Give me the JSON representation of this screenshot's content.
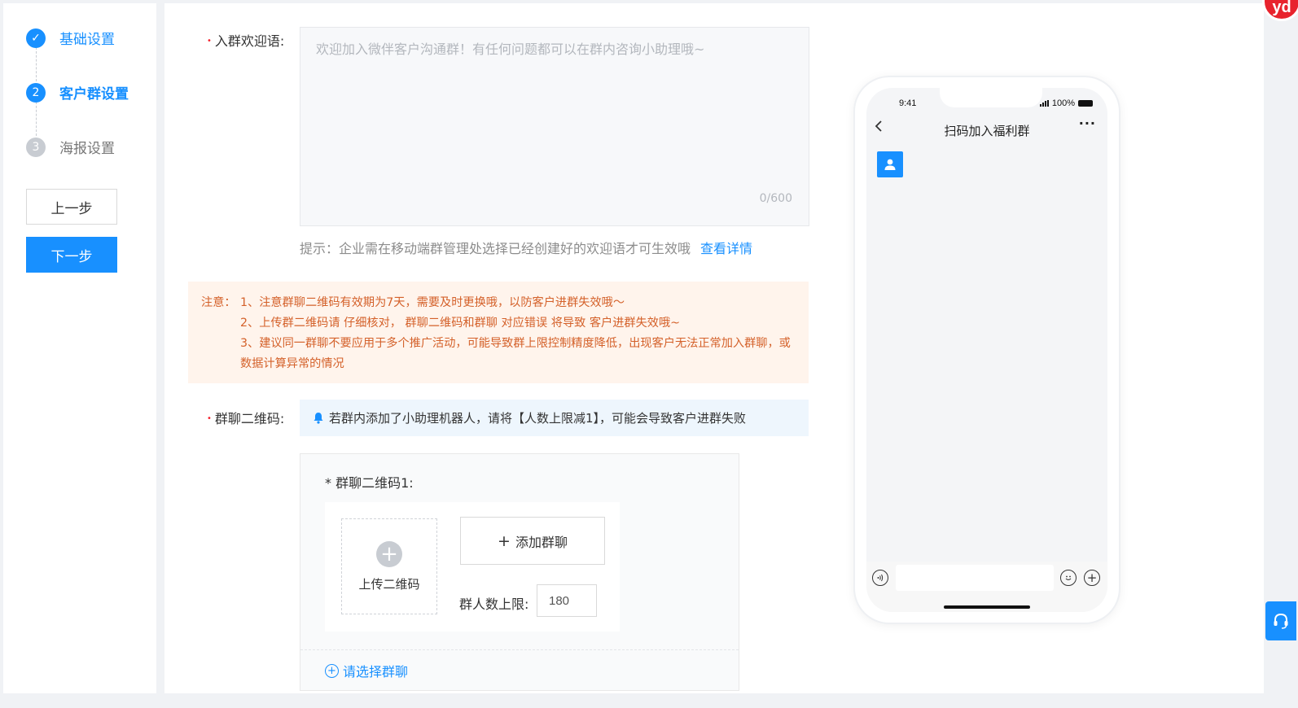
{
  "steps": [
    {
      "num": "✓",
      "label": "基础设置",
      "state": "done"
    },
    {
      "num": "2",
      "label": "客户群设置",
      "state": "active"
    },
    {
      "num": "3",
      "label": "海报设置",
      "state": "wait"
    }
  ],
  "buttons": {
    "prev": "上一步",
    "next": "下一步"
  },
  "welcome": {
    "label": "入群欢迎语:",
    "placeholder": "欢迎加入微伴客户沟通群！有任何问题都可以在群内咨询小助理哦~",
    "counter": "0/600",
    "tip": "提示：企业需在移动端群管理处选择已经创建好的欢迎语才可生效哦",
    "tip_link": "查看详情"
  },
  "notice": {
    "prefix": "注意：",
    "lines": [
      "1、注意群聊二维码有效期为7天，需要及时更换哦，以防客户进群失效哦～",
      "2、上传群二维码请 仔细核对， 群聊二维码和群聊 对应错误 将导致 客户进群失效哦~",
      "3、建议同一群聊不要应用于多个推广活动，可能导致群上限控制精度降低，出现客户无法正常加入群聊，或数据计算异常的情况"
    ]
  },
  "qr": {
    "label": "群聊二维码:",
    "info": "若群内添加了小助理机器人，请将【人数上限减1】，可能会导致客户进群失败",
    "card_title": "* 群聊二维码1:",
    "upload_text": "上传二维码",
    "add_group": "添加群聊",
    "limit_label": "群人数上限:",
    "limit_value": "180",
    "select_group": "请选择群聊"
  },
  "phone": {
    "time": "9:41",
    "battery": "100%",
    "title": "扫码加入福利群",
    "more": "···"
  },
  "corner_badge": "yd",
  "colors": {
    "primary": "#1890ff",
    "notice_bg": "#fff4ec",
    "notice_text": "#d4612a",
    "required": "#f5222d"
  }
}
